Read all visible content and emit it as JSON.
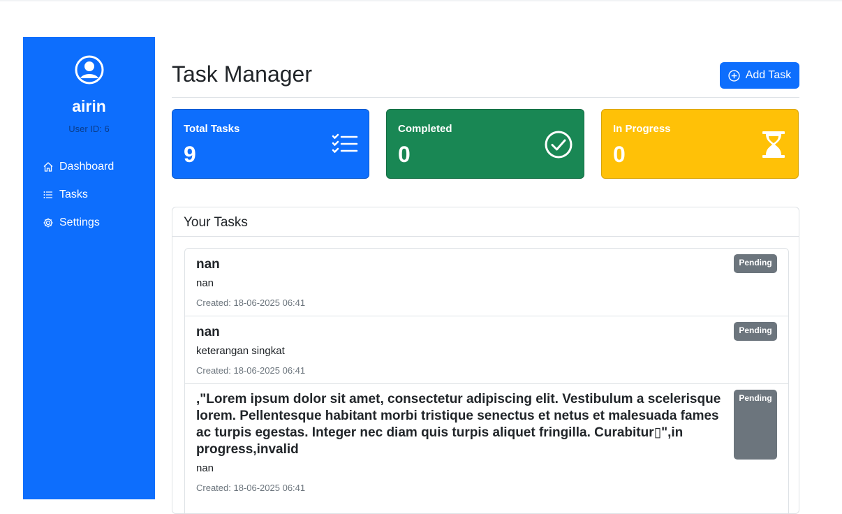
{
  "sidebar": {
    "username": "airin",
    "user_id": "User ID: 6",
    "items": [
      {
        "label": "Dashboard",
        "icon": "house-icon"
      },
      {
        "label": "Tasks",
        "icon": "list-icon"
      },
      {
        "label": "Settings",
        "icon": "gear-icon"
      }
    ]
  },
  "header": {
    "title": "Task Manager",
    "add_button_label": "Add Task"
  },
  "stats": {
    "total": {
      "label": "Total Tasks",
      "value": "9",
      "color": "#0d6efd"
    },
    "completed": {
      "label": "Completed",
      "value": "0",
      "color": "#198754"
    },
    "in_progress": {
      "label": "In Progress",
      "value": "0",
      "color": "#ffc107"
    }
  },
  "tasks_section": {
    "title": "Your Tasks",
    "tasks": [
      {
        "title": "nan",
        "description": "nan",
        "created": "Created: 18-06-2025 06:41",
        "status": "Pending"
      },
      {
        "title": "nan",
        "description": "keterangan singkat",
        "created": "Created: 18-06-2025 06:41",
        "status": "Pending"
      },
      {
        "title": ",\"Lorem ipsum dolor sit amet, consectetur adipiscing elit. Vestibulum a scelerisque lorem. Pellentesque habitant morbi tristique senectus et netus et malesuada fames ac turpis egestas. Integer nec diam quis turpis aliquet fringilla. Curabitur▯\",in progress,invalid",
        "description": "nan",
        "created": "Created: 18-06-2025 06:41",
        "status": "Pending"
      }
    ]
  }
}
